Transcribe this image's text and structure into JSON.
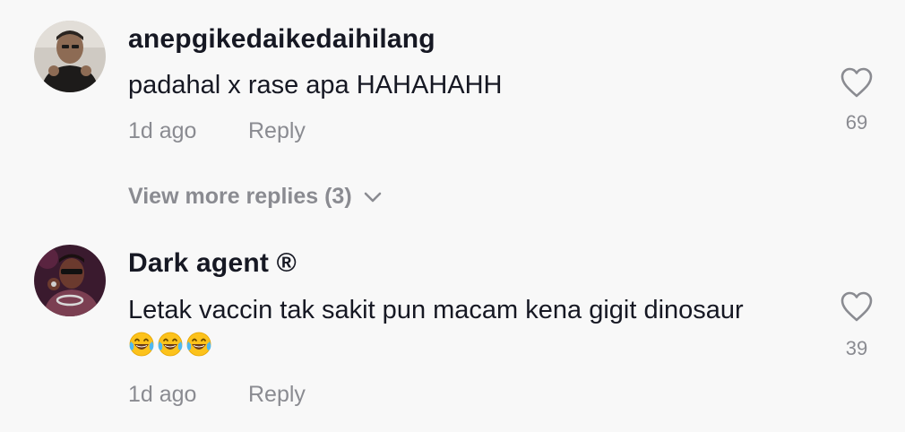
{
  "comments": [
    {
      "username": "anepgikedaikedaihilang",
      "text": "padahal x rase apa HAHAHAHH",
      "time": "1d ago",
      "reply_label": "Reply",
      "likes": "69",
      "view_more": "View more replies (3)",
      "avatar_icon": "avatar-photo",
      "colors": {
        "avatar_bg": "#c9c4bd",
        "avatar_fg": "#1d1b1a"
      }
    },
    {
      "username": "Dark agent ®",
      "text": "Letak vaccin tak sakit pun macam kena gigit dinosaur",
      "emoji": [
        "😂",
        "😂",
        "😂"
      ],
      "time": "1d ago",
      "reply_label": "Reply",
      "likes": "39",
      "avatar_icon": "avatar-photo",
      "colors": {
        "avatar_bg": "#3a1a2e",
        "avatar_fg": "#7b3f52"
      }
    }
  ],
  "icons": {
    "like": "heart-outline-icon",
    "expand": "chevron-down-icon",
    "emoji": "tears-of-joy-emoji"
  },
  "colors": {
    "background": "#f8f8f8",
    "primary_text": "#161823",
    "secondary_text": "#8a8b91"
  }
}
